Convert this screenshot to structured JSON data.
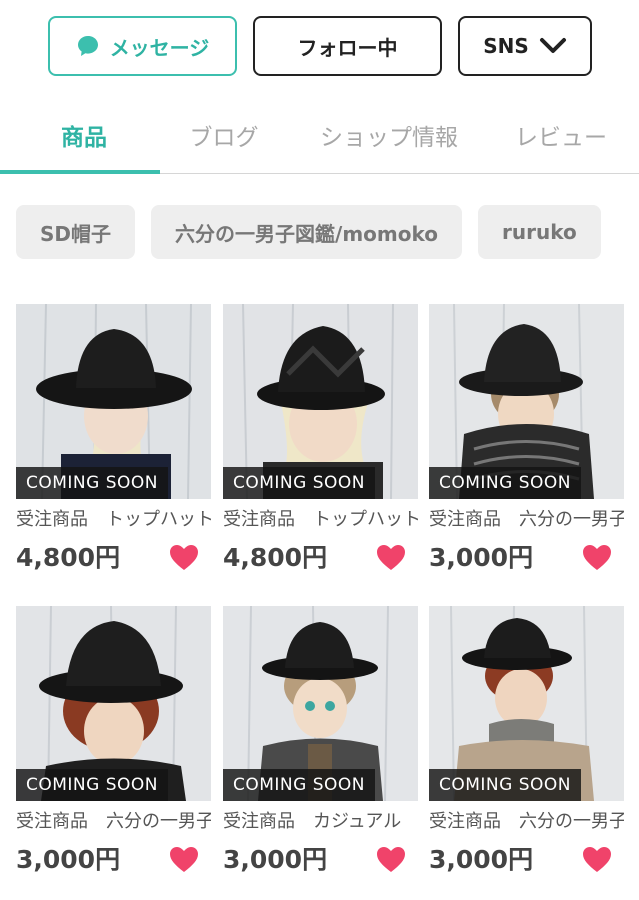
{
  "actions": {
    "message_label": "メッセージ",
    "follow_label": "フォロー中",
    "sns_label": "SNS"
  },
  "tabs": [
    {
      "label": "商品",
      "active": true
    },
    {
      "label": "ブログ",
      "active": false
    },
    {
      "label": "ショップ情報",
      "active": false
    },
    {
      "label": "レビュー",
      "active": false
    }
  ],
  "chips": [
    "SD帽子",
    "六分の一男子図鑑/momoko",
    "ruruko"
  ],
  "products": [
    {
      "badge": "COMING SOON",
      "title": "受注商品　トップハット",
      "price": "4,800円"
    },
    {
      "badge": "COMING SOON",
      "title": "受注商品　トップハット",
      "price": "4,800円"
    },
    {
      "badge": "COMING SOON",
      "title": "受注商品　六分の一男子",
      "price": "3,000円"
    },
    {
      "badge": "COMING SOON",
      "title": "受注商品　六分の一男子",
      "price": "3,000円"
    },
    {
      "badge": "COMING SOON",
      "title": "受注商品　カジュアル",
      "price": "3,000円"
    },
    {
      "badge": "COMING SOON",
      "title": "受注商品　六分の一男子",
      "price": "3,000円"
    }
  ],
  "colors": {
    "accent": "#3cbfae",
    "heart": "#f0436a"
  },
  "icons": {
    "message": "speech-bubble-icon",
    "sns": "chevron-down-icon",
    "favorite": "heart-icon"
  }
}
